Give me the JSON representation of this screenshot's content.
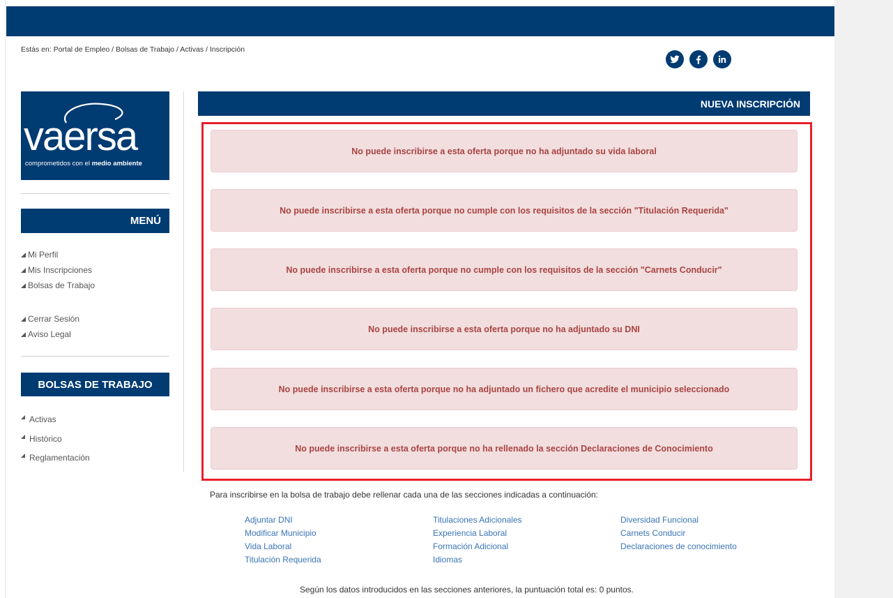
{
  "breadcrumb": {
    "prefix": "Estás en:",
    "items": [
      "Portal de Empleo",
      "Bolsas de Trabajo",
      "Activas",
      "Inscripción"
    ],
    "separator": "/"
  },
  "social": [
    "twitter-icon",
    "facebook-icon",
    "linkedin-icon"
  ],
  "logo": {
    "word": "vaersa",
    "tagline_normal": "comprometidos con el ",
    "tagline_bold": "medio ambiente"
  },
  "menu": {
    "title": "MENÚ",
    "items": [
      "Mi Perfil",
      "Mis Inscripciones",
      "Bolsas de Trabajo"
    ],
    "items2": [
      "Cerrar Sesión",
      "Aviso Legal"
    ]
  },
  "bolsas": {
    "title": "BOLSAS DE TRABAJO",
    "items": [
      "Activas",
      "Histórico",
      "Reglamentación"
    ]
  },
  "main": {
    "title": "NUEVA INSCRIPCIÓN",
    "alerts": [
      "No puede inscribirse a esta oferta porque no ha adjuntado su vida laboral",
      "No puede inscribirse a esta oferta porque no cumple con los requisitos de la sección \"Titulación Requerida\"",
      "No puede inscribirse a esta oferta porque no cumple con los requisitos de la sección \"Carnets Conducir\"",
      "No puede inscribirse a esta oferta porque no ha adjuntado su DNI",
      "No puede inscribirse a esta oferta porque no ha adjuntado un fichero que acredite el municipio seleccionado",
      "No puede inscribirse a esta oferta porque no ha rellenado la sección Declaraciones de Conocimiento"
    ],
    "intro": "Para inscribirse en la bolsa de trabajo debe rellenar cada una de las secciones indicadas a continuación:",
    "links_col1": [
      "Adjuntar DNI",
      "Modificar Municipio",
      "Vida Laboral",
      "Titulación Requerida"
    ],
    "links_col2": [
      "Titulaciones Adicionales",
      "Experiencia Laboral",
      "Formación Adicional",
      "Idiomas"
    ],
    "links_col3": [
      "Diversidad Funcional",
      "Carnets Conducir",
      "Declaraciones de conocimiento"
    ],
    "total": "Según los datos introducidos en las secciones anteriores, la puntuación total es: 0 puntos."
  },
  "colors": {
    "brand": "#003b72",
    "alert_bg": "#f2dede",
    "alert_text": "#a94442",
    "highlight": "#e8202a",
    "link": "#3a74b5"
  }
}
